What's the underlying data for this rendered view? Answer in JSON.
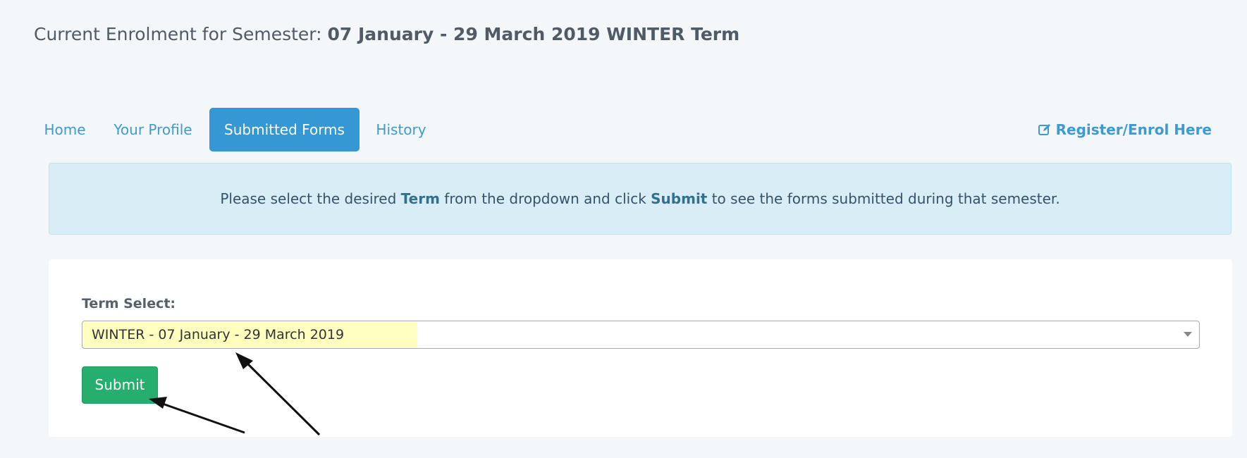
{
  "header": {
    "prefix": "Current Enrolment for Semester: ",
    "term": "07 January - 29 March 2019 WINTER Term"
  },
  "nav": {
    "tabs": [
      {
        "label": "Home",
        "active": false
      },
      {
        "label": "Your Profile",
        "active": false
      },
      {
        "label": "Submitted Forms",
        "active": true
      },
      {
        "label": "History",
        "active": false
      }
    ],
    "register_link": {
      "label": "Register/Enrol Here",
      "icon": "edit-icon"
    }
  },
  "info": {
    "part1": "Please select the desired ",
    "bold1": "Term",
    "part2": " from the dropdown and click ",
    "bold2": "Submit",
    "part3": " to see the forms submitted during that semester."
  },
  "form": {
    "term_label": "Term Select:",
    "selected_term": "WINTER - 07 January - 29 March 2019",
    "submit_label": "Submit"
  },
  "colors": {
    "accent": "#3598d5",
    "submit": "#26ae6e",
    "info_bg": "#d9edf6",
    "select_highlight": "#ffffc0"
  }
}
